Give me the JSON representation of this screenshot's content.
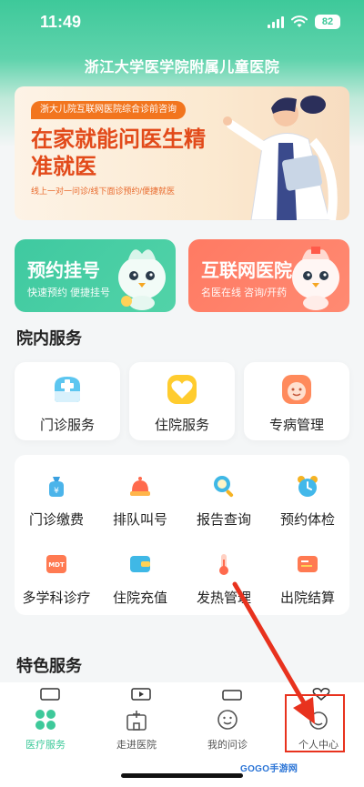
{
  "status_bar": {
    "time": "11:49",
    "battery": "82"
  },
  "header": {
    "title": "浙江大学医学院附属儿童医院"
  },
  "banner": {
    "tag": "浙大儿院互联网医院综合诊前咨询",
    "headline": "在家就能问医生精准就医",
    "subtitle": "线上一对一问诊/线下面诊预约/便捷就医"
  },
  "quick_cards": [
    {
      "title": "预约挂号",
      "subtitle": "快速预约 便捷挂号",
      "color": "#45cca3"
    },
    {
      "title": "互联网医院",
      "subtitle": "名医在线 咨询/开药",
      "color": "#ff7d66"
    }
  ],
  "inhospital": {
    "title": "院内服务",
    "cards": [
      {
        "label": "门诊服务",
        "icon": "outpatient-icon"
      },
      {
        "label": "住院服务",
        "icon": "inpatient-heart-icon"
      },
      {
        "label": "专病管理",
        "icon": "disease-management-icon"
      }
    ],
    "grid": [
      {
        "label": "门诊缴费",
        "icon": "payment-bag-icon"
      },
      {
        "label": "排队叫号",
        "icon": "queue-bell-icon"
      },
      {
        "label": "报告查询",
        "icon": "report-search-icon"
      },
      {
        "label": "预约体检",
        "icon": "checkup-clock-icon"
      },
      {
        "label": "多学科诊疗",
        "icon": "mdt-icon"
      },
      {
        "label": "住院充值",
        "icon": "wallet-icon"
      },
      {
        "label": "发热管理",
        "icon": "thermometer-icon"
      },
      {
        "label": "出院结算",
        "icon": "discharge-card-icon"
      }
    ]
  },
  "featured": {
    "title": "特色服务"
  },
  "tabbar": [
    {
      "label": "医疗服务",
      "icon": "medical-grid-icon",
      "active": true
    },
    {
      "label": "走进医院",
      "icon": "hospital-icon",
      "active": false
    },
    {
      "label": "我的问诊",
      "icon": "consult-face-icon",
      "active": false
    },
    {
      "label": "个人中心",
      "icon": "profile-icon",
      "active": false
    }
  ],
  "watermark": "GOGO手游网",
  "colors": {
    "brand": "#3ec99a",
    "annotation": "#e8321e"
  }
}
